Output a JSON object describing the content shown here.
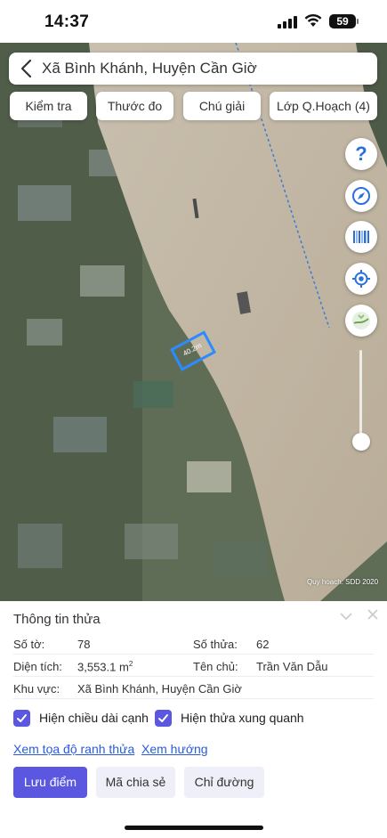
{
  "status_bar": {
    "time": "14:37",
    "battery": "59"
  },
  "header": {
    "location_title": "Xã Bình Khánh, Huyện Cần Giờ"
  },
  "toolbar": {
    "check_label": "Kiểm tra",
    "measure_label": "Thước đo",
    "legend_label": "Chú giải",
    "planning_layer_label": "Lớp Q.Hoạch (4)"
  },
  "map": {
    "help_glyph": "?",
    "parcel_label": "40.2m",
    "watermark": "Quy hoạch: SDD 2020",
    "parcel_color": "#2c8cff"
  },
  "panel": {
    "title": "Thông tin thửa",
    "rows": {
      "sheet_label": "Số tờ:",
      "sheet_value": "78",
      "parcel_no_label": "Số thửa:",
      "parcel_no_value": "62",
      "area_label": "Diện tích:",
      "area_value": "3,553.1 m",
      "area_unit_sup": "2",
      "owner_label": "Tên chủ:",
      "owner_value": "Trần Văn Dẫu",
      "region_label": "Khu vực:",
      "region_value": "Xã Bình Khánh, Huyện Cần Giờ"
    },
    "checkboxes": {
      "show_edge_length": "Hiện chiều dài cạnh",
      "show_neighbors": "Hiện thửa xung quanh"
    },
    "links": {
      "view_coordinates": "Xem tọa độ ranh thửa",
      "view_direction": "Xem hướng"
    },
    "buttons": {
      "save_point": "Lưu điểm",
      "share_code": "Mã chia sẻ",
      "directions": "Chỉ đường"
    }
  },
  "colors": {
    "accent": "#5b57e0",
    "link": "#2a5bd7",
    "fab_blue": "#2a6fdb"
  }
}
